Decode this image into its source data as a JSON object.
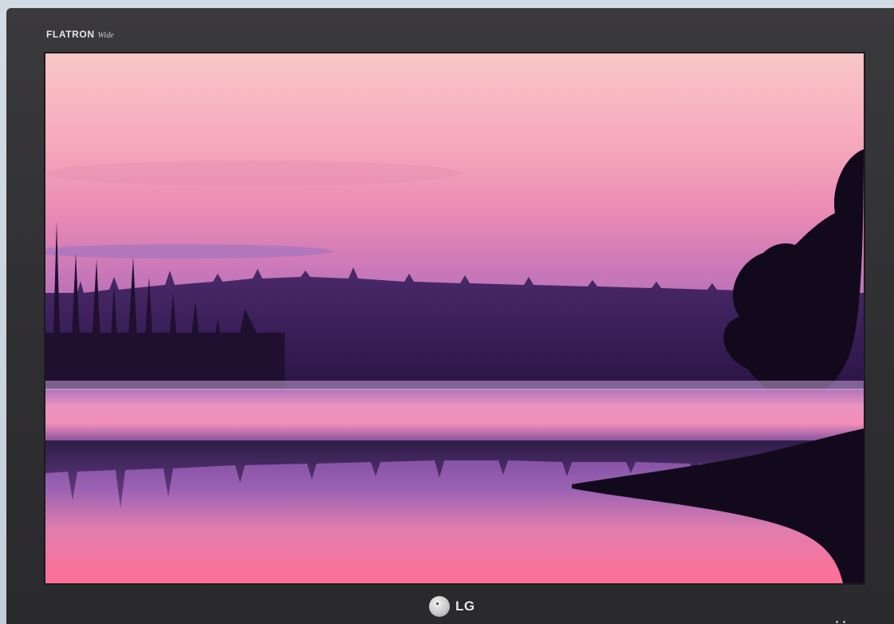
{
  "monitor": {
    "brand": "FLATRON",
    "model_script": "Wide",
    "logo_text": "LG"
  },
  "colors": {
    "sky_top": "#f7c3c9",
    "sky_mid": "#f28ea6",
    "sky_low": "#b466b0",
    "forest": "#3d1f5a",
    "water_top": "#e89ac0",
    "water_bottom": "#ff6f95",
    "bezel": "#333236"
  },
  "image": {
    "subject": "sunset-lake-forest-reflection"
  }
}
